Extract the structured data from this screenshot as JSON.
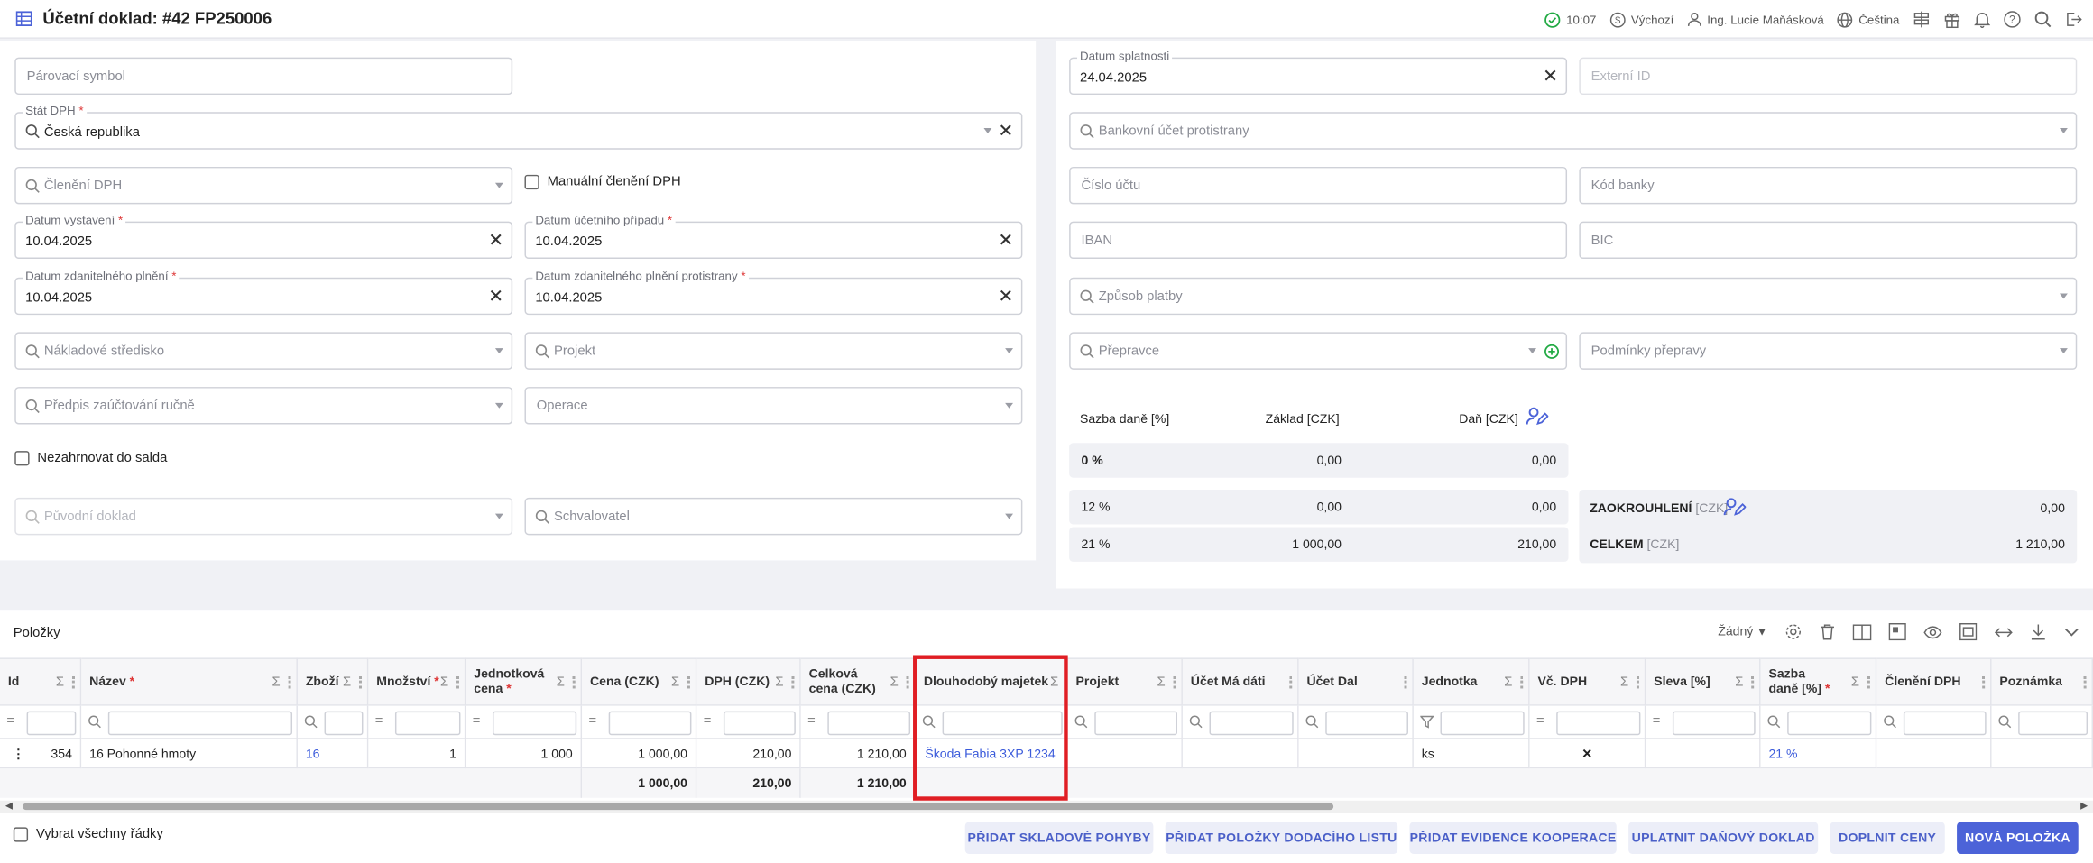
{
  "header": {
    "title": "Účetní doklad: #42 FP250006",
    "time": "10:07",
    "currency_mode": "Výchozí",
    "user": "Ing. Lucie Maňásková",
    "language": "Čeština"
  },
  "left_form": {
    "parovaci_symbol": {
      "placeholder": "Párovací symbol"
    },
    "stat_dph": {
      "label": "Stát DPH",
      "value": "Česká republika"
    },
    "cleneni_dph": {
      "placeholder": "Členění DPH"
    },
    "manualni_cleneni": "Manuální členění DPH",
    "datum_vystaveni": {
      "label": "Datum vystavení",
      "value": "10.04.2025"
    },
    "datum_ucetniho": {
      "label": "Datum účetního případu",
      "value": "10.04.2025"
    },
    "datum_zdanitelneho": {
      "label": "Datum zdanitelného plnění",
      "value": "10.04.2025"
    },
    "datum_zdanitelneho_protistrany": {
      "label": "Datum zdanitelného plnění protistrany",
      "value": "10.04.2025"
    },
    "nakladove_stredisko": {
      "placeholder": "Nákladové středisko"
    },
    "projekt": {
      "placeholder": "Projekt"
    },
    "predpis": {
      "placeholder": "Předpis zaúčtování ručně"
    },
    "operace": {
      "placeholder": "Operace"
    },
    "nezahrnovat": "Nezahrnovat do salda",
    "puvodni_doklad": {
      "placeholder": "Původní doklad"
    },
    "schvalovatel": {
      "placeholder": "Schvalovatel"
    }
  },
  "right_form": {
    "datum_splatnosti": {
      "label": "Datum splatnosti",
      "value": "24.04.2025"
    },
    "externi_id": {
      "placeholder": "Externí ID"
    },
    "bankovni_ucet": {
      "placeholder": "Bankovní účet protistrany"
    },
    "cislo_uctu": {
      "placeholder": "Číslo účtu"
    },
    "kod_banky": {
      "placeholder": "Kód banky"
    },
    "iban": {
      "placeholder": "IBAN"
    },
    "bic": {
      "placeholder": "BIC"
    },
    "zpusob_platby": {
      "placeholder": "Způsob platby"
    },
    "prepravce": {
      "placeholder": "Přepravce"
    },
    "podminky_prepravy": {
      "placeholder": "Podmínky přepravy"
    }
  },
  "tax_table": {
    "headers": [
      "Sazba daně [%]",
      "Základ [CZK]",
      "Daň [CZK]"
    ],
    "rows": [
      {
        "rate": "0 %",
        "base": "0,00",
        "tax": "0,00"
      },
      {
        "rate": "12 %",
        "base": "0,00",
        "tax": "0,00"
      },
      {
        "rate": "21 %",
        "base": "1 000,00",
        "tax": "210,00"
      }
    ],
    "rounding_label": "ZAOKROUHLENÍ",
    "rounding_unit": "[CZK]",
    "rounding_value": "0,00",
    "total_label": "CELKEM",
    "total_unit": "[CZK]",
    "total_value": "1 210,00"
  },
  "items": {
    "title": "Položky",
    "view_select": "Žádný",
    "columns": [
      {
        "title": "Id",
        "req": false
      },
      {
        "title": "Název",
        "req": true
      },
      {
        "title": "Zboží",
        "req": false
      },
      {
        "title": "Množství",
        "req": true
      },
      {
        "title": "Jednotková cena",
        "req": true
      },
      {
        "title": "Cena (CZK)",
        "req": false
      },
      {
        "title": "DPH (CZK)",
        "req": false
      },
      {
        "title": "Celková cena (CZK)",
        "req": false
      },
      {
        "title": "Dlouhodobý majetek",
        "req": false
      },
      {
        "title": "Projekt",
        "req": false
      },
      {
        "title": "Účet Má dáti",
        "req": false
      },
      {
        "title": "Účet Dal",
        "req": false
      },
      {
        "title": "Jednotka",
        "req": false
      },
      {
        "title": "Vč. DPH",
        "req": false
      },
      {
        "title": "Sleva [%]",
        "req": false
      },
      {
        "title": "Sazba daně [%]",
        "req": true
      },
      {
        "title": "Členění DPH",
        "req": false
      },
      {
        "title": "Poznámka",
        "req": false
      }
    ],
    "row": {
      "id": "354",
      "nazev": "16 Pohonné hmoty",
      "zbozi": "16",
      "mnozstvi": "1",
      "jednotkova_cena": "1 000",
      "cena": "1 000,00",
      "dph": "210,00",
      "celkova_cena": "1 210,00",
      "majetek": "Škoda Fabia 3XP 1234",
      "jednotka": "ks",
      "vc_dph": "✕",
      "sazba": "21 %"
    },
    "totals": {
      "cena": "1 000,00",
      "dph": "210,00",
      "celkova_cena": "1 210,00"
    },
    "select_all": "Vybrat všechny řádky",
    "buttons": [
      "PŘIDAT SKLADOVÉ POHYBY",
      "PŘIDAT POLOŽKY DODACÍHO LISTU",
      "PŘIDAT EVIDENCE KOOPERACE",
      "UPLATNIT DAŇOVÝ DOKLAD",
      "DOPLNIT CENY",
      "NOVÁ POLOŽKA"
    ]
  },
  "colors": {
    "accent": "#4c63d8",
    "link": "#3b5bdb",
    "highlight": "#e01e24",
    "required": "#dd3333",
    "ok": "#22aa44"
  }
}
